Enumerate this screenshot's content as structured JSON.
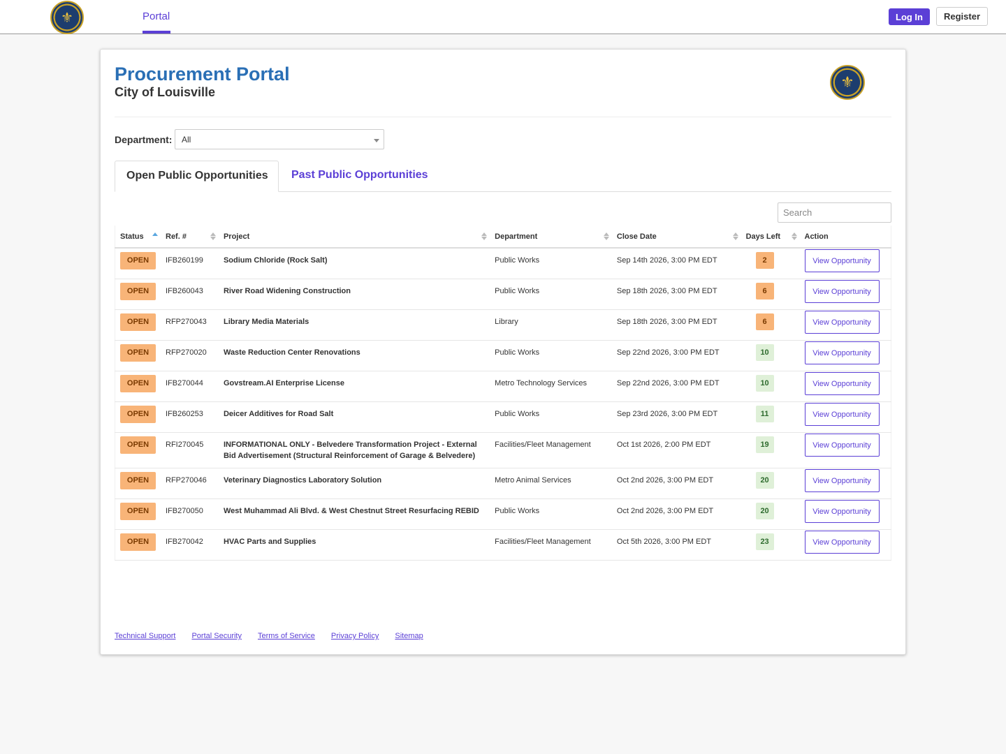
{
  "nav": {
    "seal_icon": "louisville-seal-icon",
    "portal_tab": "Portal",
    "login_label": "Log In",
    "register_label": "Register"
  },
  "header": {
    "title": "Procurement Portal",
    "subtitle": "City of Louisville"
  },
  "filter": {
    "department_label": "Department:",
    "department_value": "All"
  },
  "tabs": [
    {
      "label": "Open Public Opportunities",
      "active": true
    },
    {
      "label": "Past Public Opportunities",
      "active": false
    }
  ],
  "search": {
    "placeholder": "Search"
  },
  "table": {
    "columns": [
      "Status",
      "Ref. #",
      "Project",
      "Department",
      "Close Date",
      "Days Left",
      "Action"
    ],
    "rows": [
      {
        "status": "OPEN",
        "ref": "IFB260199",
        "project": "Sodium Chloride (Rock Salt)",
        "department": "Public Works",
        "close_date": "Sep 14th 2026, 3:00 PM EDT",
        "days_left": "2",
        "days_style": "warn",
        "action": "View Opportunity"
      },
      {
        "status": "OPEN",
        "ref": "IFB260043",
        "project": "River Road Widening Construction",
        "department": "Public Works",
        "close_date": "Sep 18th 2026, 3:00 PM EDT",
        "days_left": "6",
        "days_style": "warn",
        "action": "View Opportunity"
      },
      {
        "status": "OPEN",
        "ref": "RFP270043",
        "project": "Library Media Materials",
        "department": "Library",
        "close_date": "Sep 18th 2026, 3:00 PM EDT",
        "days_left": "6",
        "days_style": "warn",
        "action": "View Opportunity"
      },
      {
        "status": "OPEN",
        "ref": "RFP270020",
        "project": "Waste Reduction Center Renovations",
        "department": "Public Works",
        "close_date": "Sep 22nd 2026, 3:00 PM EDT",
        "days_left": "10",
        "days_style": "ok",
        "action": "View Opportunity"
      },
      {
        "status": "OPEN",
        "ref": "IFB270044",
        "project": "Govstream.AI Enterprise License",
        "department": "Metro Technology Services",
        "close_date": "Sep 22nd 2026, 3:00 PM EDT",
        "days_left": "10",
        "days_style": "ok",
        "action": "View Opportunity"
      },
      {
        "status": "OPEN",
        "ref": "IFB260253",
        "project": "Deicer Additives for Road Salt",
        "department": "Public Works",
        "close_date": "Sep 23rd 2026, 3:00 PM EDT",
        "days_left": "11",
        "days_style": "ok",
        "action": "View Opportunity"
      },
      {
        "status": "OPEN",
        "ref": "RFI270045",
        "project": "INFORMATIONAL ONLY - Belvedere Transformation Project - External Bid Advertisement (Structural Reinforcement of Garage & Belvedere)",
        "department": "Facilities/Fleet Management",
        "close_date": "Oct 1st 2026, 2:00 PM EDT",
        "days_left": "19",
        "days_style": "ok",
        "action": "View Opportunity"
      },
      {
        "status": "OPEN",
        "ref": "RFP270046",
        "project": "Veterinary Diagnostics Laboratory Solution",
        "department": "Metro Animal Services",
        "close_date": "Oct 2nd 2026, 3:00 PM EDT",
        "days_left": "20",
        "days_style": "ok",
        "action": "View Opportunity"
      },
      {
        "status": "OPEN",
        "ref": "IFB270050",
        "project": "West Muhammad Ali Blvd. & West Chestnut Street Resurfacing REBID",
        "department": "Public Works",
        "close_date": "Oct 2nd 2026, 3:00 PM EDT",
        "days_left": "20",
        "days_style": "ok",
        "action": "View Opportunity"
      },
      {
        "status": "OPEN",
        "ref": "IFB270042",
        "project": "HVAC Parts and Supplies",
        "department": "Facilities/Fleet Management",
        "close_date": "Oct 5th 2026, 3:00 PM EDT",
        "days_left": "23",
        "days_style": "ok",
        "action": "View Opportunity"
      }
    ]
  },
  "footer": {
    "links": [
      "Technical Support",
      "Portal Security",
      "Terms of Service",
      "Privacy Policy",
      "Sitemap"
    ]
  },
  "colors": {
    "accent": "#5b3fd6",
    "title_blue": "#2a6fb5",
    "open_badge": "#f8b478",
    "days_ok": "#dff0d8"
  }
}
